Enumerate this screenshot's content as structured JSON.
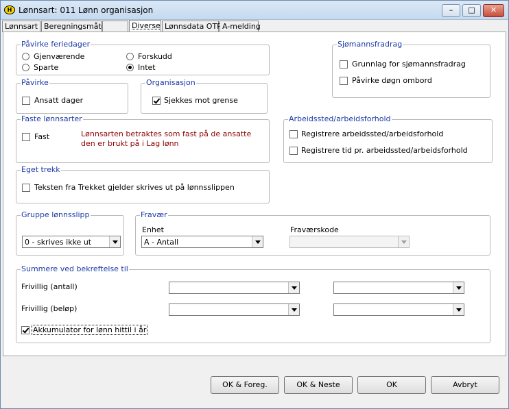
{
  "window": {
    "title": "Lønnsart: 011 Lønn organisasjon",
    "icon_text": "H",
    "minimize": "–",
    "restore": "□",
    "close": "✕"
  },
  "tabs": [
    "Lønnsart",
    "Beregningsmåte",
    "",
    "Diverse",
    "Lønnsdata OTP",
    "A-melding"
  ],
  "feriedager": {
    "title": "Påvirke feriedager",
    "options": [
      "Gjenværende",
      "Forskudd",
      "Sparte",
      "Intet"
    ],
    "selected": "Intet"
  },
  "sjomann": {
    "title": "Sjømannsfradrag",
    "grunnlag": "Grunnlag for sjømannsfradrag",
    "pavirke": "Påvirke døgn ombord"
  },
  "pavirke": {
    "title": "Påvirke",
    "ansatt_dager": "Ansatt dager"
  },
  "organisasjon": {
    "title": "Organisasjon",
    "sjekkes": "Sjekkes mot grense"
  },
  "faste": {
    "title": "Faste lønnsarter",
    "fast": "Fast",
    "info": "Lønnsarten betraktes som fast på de ansatte den er brukt på i Lag lønn"
  },
  "arbeidssted": {
    "title": "Arbeidssted/arbeidsforhold",
    "reg1": "Registrere arbeidssted/arbeidsforhold",
    "reg2": "Registrere tid pr. arbeidssted/arbeidsforhold"
  },
  "eget_trekk": {
    "title": "Eget trekk",
    "tekst": "Teksten fra Trekket gjelder skrives ut på lønnsslippen"
  },
  "gruppe": {
    "title": "Gruppe lønnsslipp",
    "value": "0 - skrives ikke ut"
  },
  "fravaer": {
    "title": "Fravær",
    "enhet_label": "Enhet",
    "enhet_value": "A - Antall",
    "kode_label": "Fraværskode",
    "kode_value": ""
  },
  "summere": {
    "title": "Summere ved bekreftelse til",
    "row1": "Frivillig (antall)",
    "row2": "Frivillig (beløp)",
    "akkumulator": "Akkumulator for lønn hittil i år"
  },
  "buttons": {
    "ok_foreg": "OK & Foreg.",
    "ok_neste": "OK & Neste",
    "ok": "OK",
    "avbryt": "Avbryt"
  },
  "colors": {
    "group_title": "#1b3aa7",
    "info_text": "#8b0000"
  }
}
